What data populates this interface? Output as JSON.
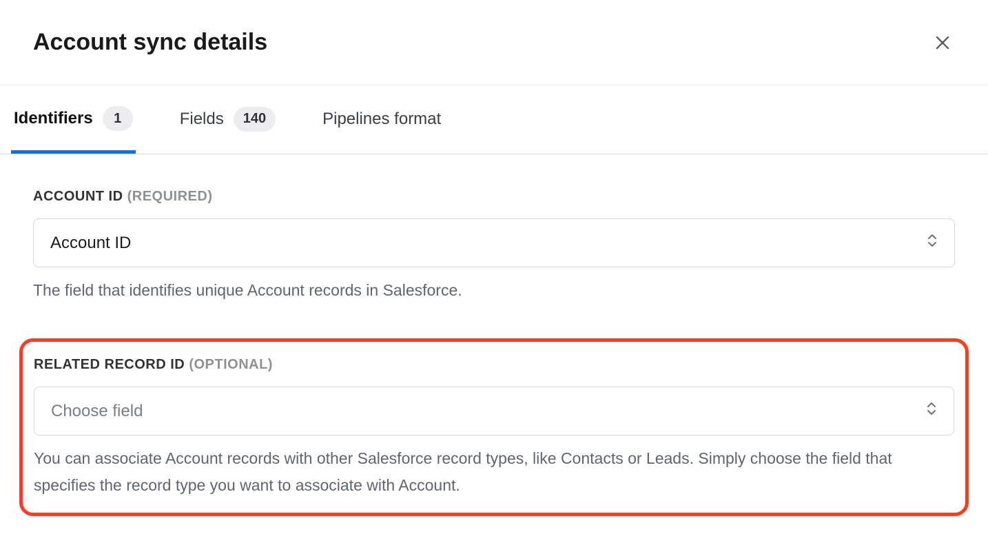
{
  "header": {
    "title": "Account sync details"
  },
  "tabs": [
    {
      "label": "Identifiers",
      "count": "1",
      "active": true
    },
    {
      "label": "Fields",
      "count": "140",
      "active": false
    },
    {
      "label": "Pipelines format",
      "count": null,
      "active": false
    }
  ],
  "account_id": {
    "label": "ACCOUNT ID",
    "qualifier": "(REQUIRED)",
    "value": "Account ID",
    "help": "The field that identifies unique Account records in Salesforce."
  },
  "related_record_id": {
    "label": "RELATED RECORD ID",
    "qualifier": "(OPTIONAL)",
    "placeholder": "Choose field",
    "help": "You can associate Account records with other Salesforce record types, like Contacts or Leads. Simply choose the field that specifies the record type you want to associate with Account."
  }
}
